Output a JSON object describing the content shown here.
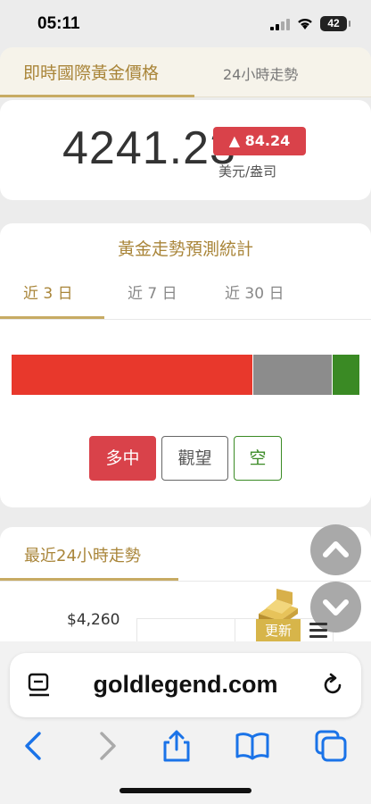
{
  "status": {
    "time": "05:11",
    "battery": "42"
  },
  "top_tabs": {
    "active": "即時國際黃金價格",
    "inactive": "24小時走勢"
  },
  "price": {
    "value": "4241.23",
    "change": "▲ 84.24",
    "unit": "美元/盎司"
  },
  "prediction": {
    "title": "黃金走勢預測統計",
    "tabs": [
      "近 3 日",
      "近 7 日",
      "近 30 日"
    ],
    "bar": [
      {
        "label": "多中",
        "fraction": 0.67,
        "color": "#e8382c"
      },
      {
        "label": "觀望",
        "fraction": 0.22,
        "color": "#8c8c8c"
      },
      {
        "label": "空",
        "fraction": 0.08,
        "color": "#3a8a24"
      }
    ],
    "buttons": [
      "多中",
      "觀望",
      "空"
    ]
  },
  "trend": {
    "title": "最近24小時走勢",
    "y_label": "$4,260"
  },
  "widgets": {
    "update": "更新"
  },
  "browser": {
    "url": "goldlegend.com"
  }
}
